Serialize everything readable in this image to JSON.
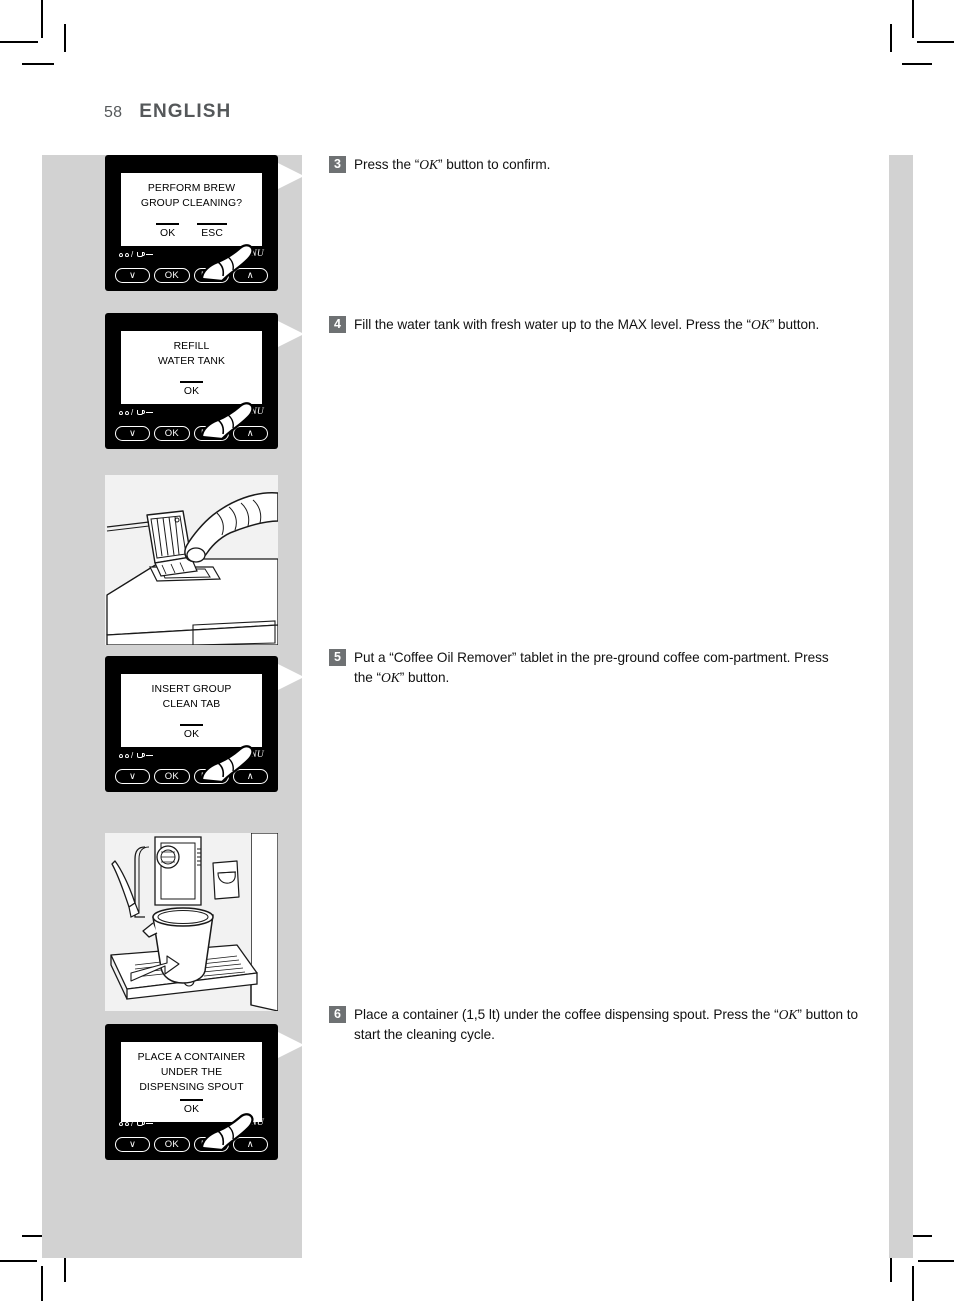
{
  "header": {
    "page_number": "58",
    "language": "ENGLISH"
  },
  "colors": {
    "band_gray": "#d2d2d2",
    "step_badge_gray": "#6e7173",
    "header_gray": "#55585a",
    "lcd_black": "#000000",
    "illustration_bg": "#f2f2f2"
  },
  "display_controls": {
    "icon_label": "coffee-beans-cup-icon",
    "down_button": "∨",
    "ok_button": "OK",
    "esc_button": "ESC",
    "menu_label": "MENU",
    "up_button": "∧"
  },
  "panels": [
    {
      "id": "perform-brew-group-cleaning",
      "lines": [
        "PERFORM BREW",
        "GROUP CLEANING?"
      ],
      "options": [
        "OK",
        "ESC"
      ]
    },
    {
      "id": "refill-water-tank",
      "lines": [
        "REFILL",
        "WATER TANK"
      ],
      "options": [
        "OK"
      ]
    },
    {
      "id": "insert-group-clean-tab",
      "lines": [
        "INSERT GROUP",
        "CLEAN TAB"
      ],
      "options": [
        "OK"
      ]
    },
    {
      "id": "place-container-under-spout",
      "lines": [
        "PLACE A CONTAINER",
        "UNDER THE",
        "DISPENSING SPOUT"
      ],
      "options": [
        "OK"
      ]
    }
  ],
  "illustrations": [
    {
      "id": "pre-ground-compartment-lid",
      "alt": "hand opening the pre-ground coffee compartment lid on top of the machine"
    },
    {
      "id": "container-under-dispensing-spout",
      "alt": "container placed under the coffee dispensing spout of the machine"
    }
  ],
  "steps": [
    {
      "number": "3",
      "parts": [
        {
          "type": "text",
          "value": "Press the “"
        },
        {
          "type": "ok",
          "value": "OK"
        },
        {
          "type": "text",
          "value": "” button to confirm."
        }
      ]
    },
    {
      "number": "4",
      "parts": [
        {
          "type": "text",
          "value": "Fill the water tank with fresh water up to the MAX level. Press the “"
        },
        {
          "type": "ok",
          "value": "OK"
        },
        {
          "type": "text",
          "value": "” button."
        }
      ]
    },
    {
      "number": "5",
      "parts": [
        {
          "type": "text",
          "value": "Put a “Coffee Oil Remover” tablet in the pre-ground coffee com-partment. Press the “"
        },
        {
          "type": "ok",
          "value": "OK"
        },
        {
          "type": "text",
          "value": "” button."
        }
      ]
    },
    {
      "number": "6",
      "parts": [
        {
          "type": "text",
          "value": "Place a container (1,5 lt) under the coffee dispensing spout. Press the “"
        },
        {
          "type": "ok",
          "value": "OK"
        },
        {
          "type": "text",
          "value": "” button to start the cleaning cycle."
        }
      ]
    }
  ]
}
